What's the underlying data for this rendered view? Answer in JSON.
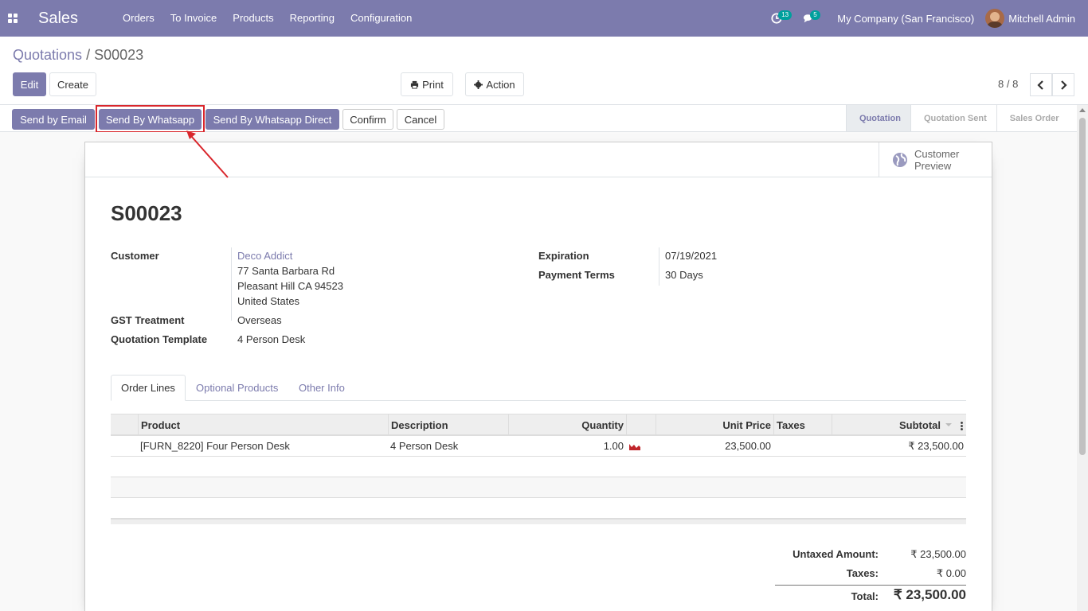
{
  "navbar": {
    "app_name": "Sales",
    "menu": [
      "Orders",
      "To Invoice",
      "Products",
      "Reporting",
      "Configuration"
    ],
    "activity_count": "13",
    "message_count": "5",
    "company": "My Company (San Francisco)",
    "user": "Mitchell Admin",
    "bg_color": "#7c7bad"
  },
  "breadcrumb": {
    "parent": "Quotations",
    "separator": "/",
    "current": "S00023"
  },
  "control": {
    "edit": "Edit",
    "create": "Create",
    "print": "Print",
    "action": "Action",
    "pager": "8 / 8"
  },
  "statusbar": {
    "buttons": [
      "Send by Email",
      "Send By Whatsapp",
      "Send By Whatsapp Direct",
      "Confirm",
      "Cancel"
    ],
    "stages": [
      "Quotation",
      "Quotation Sent",
      "Sales Order"
    ],
    "active_stage": "Quotation"
  },
  "sheet": {
    "smart_button": {
      "line1": "Customer",
      "line2": "Preview",
      "icon": "globe-icon"
    },
    "title": "S00023",
    "customer_label": "Customer",
    "customer_name": "Deco Addict",
    "address": [
      "77 Santa Barbara Rd",
      "Pleasant Hill CA 94523",
      "United States"
    ],
    "gst_label": "GST Treatment",
    "gst_value": "Overseas",
    "template_label": "Quotation Template",
    "template_value": "4 Person Desk",
    "expiration_label": "Expiration",
    "expiration_value": "07/19/2021",
    "payment_label": "Payment Terms",
    "payment_value": "30 Days"
  },
  "tabs": [
    "Order Lines",
    "Optional Products",
    "Other Info"
  ],
  "order_lines": {
    "columns": [
      "Product",
      "Description",
      "Quantity",
      "Unit Price",
      "Taxes",
      "Subtotal"
    ],
    "rows": [
      {
        "product": "[FURN_8220] Four Person Desk",
        "description": "4 Person Desk",
        "quantity": "1.00",
        "unit_price": "23,500.00",
        "taxes": "",
        "subtotal": "₹ 23,500.00"
      }
    ]
  },
  "totals": {
    "untaxed_label": "Untaxed Amount:",
    "untaxed_value": "₹ 23,500.00",
    "taxes_label": "Taxes:",
    "taxes_value": "₹ 0.00",
    "total_label": "Total:",
    "total_value": "₹ 23,500.00"
  },
  "annotation_color": "#d9262c"
}
